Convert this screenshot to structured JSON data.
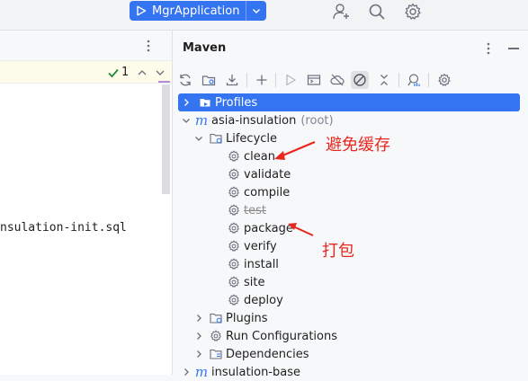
{
  "run_config": {
    "label": "MgrApplication"
  },
  "editor": {
    "inspection_count": "1",
    "file_line": "nsulation-init.sql"
  },
  "maven": {
    "title": "Maven",
    "tree": {
      "profiles": "Profiles",
      "root_name": "asia-insulation",
      "root_suffix": "(root)",
      "lifecycle": "Lifecycle",
      "goals": [
        "clean",
        "validate",
        "compile",
        "test",
        "package",
        "verify",
        "install",
        "site",
        "deploy"
      ],
      "plugins": "Plugins",
      "run_configurations": "Run Configurations",
      "dependencies": "Dependencies",
      "next_module": "insulation-base"
    }
  },
  "annotations": {
    "clean_note": "避免缓存",
    "package_note": "打包"
  },
  "colors": {
    "accent": "#3574f0",
    "annotation": "#e8281e",
    "maven_m": "#3574f0"
  }
}
